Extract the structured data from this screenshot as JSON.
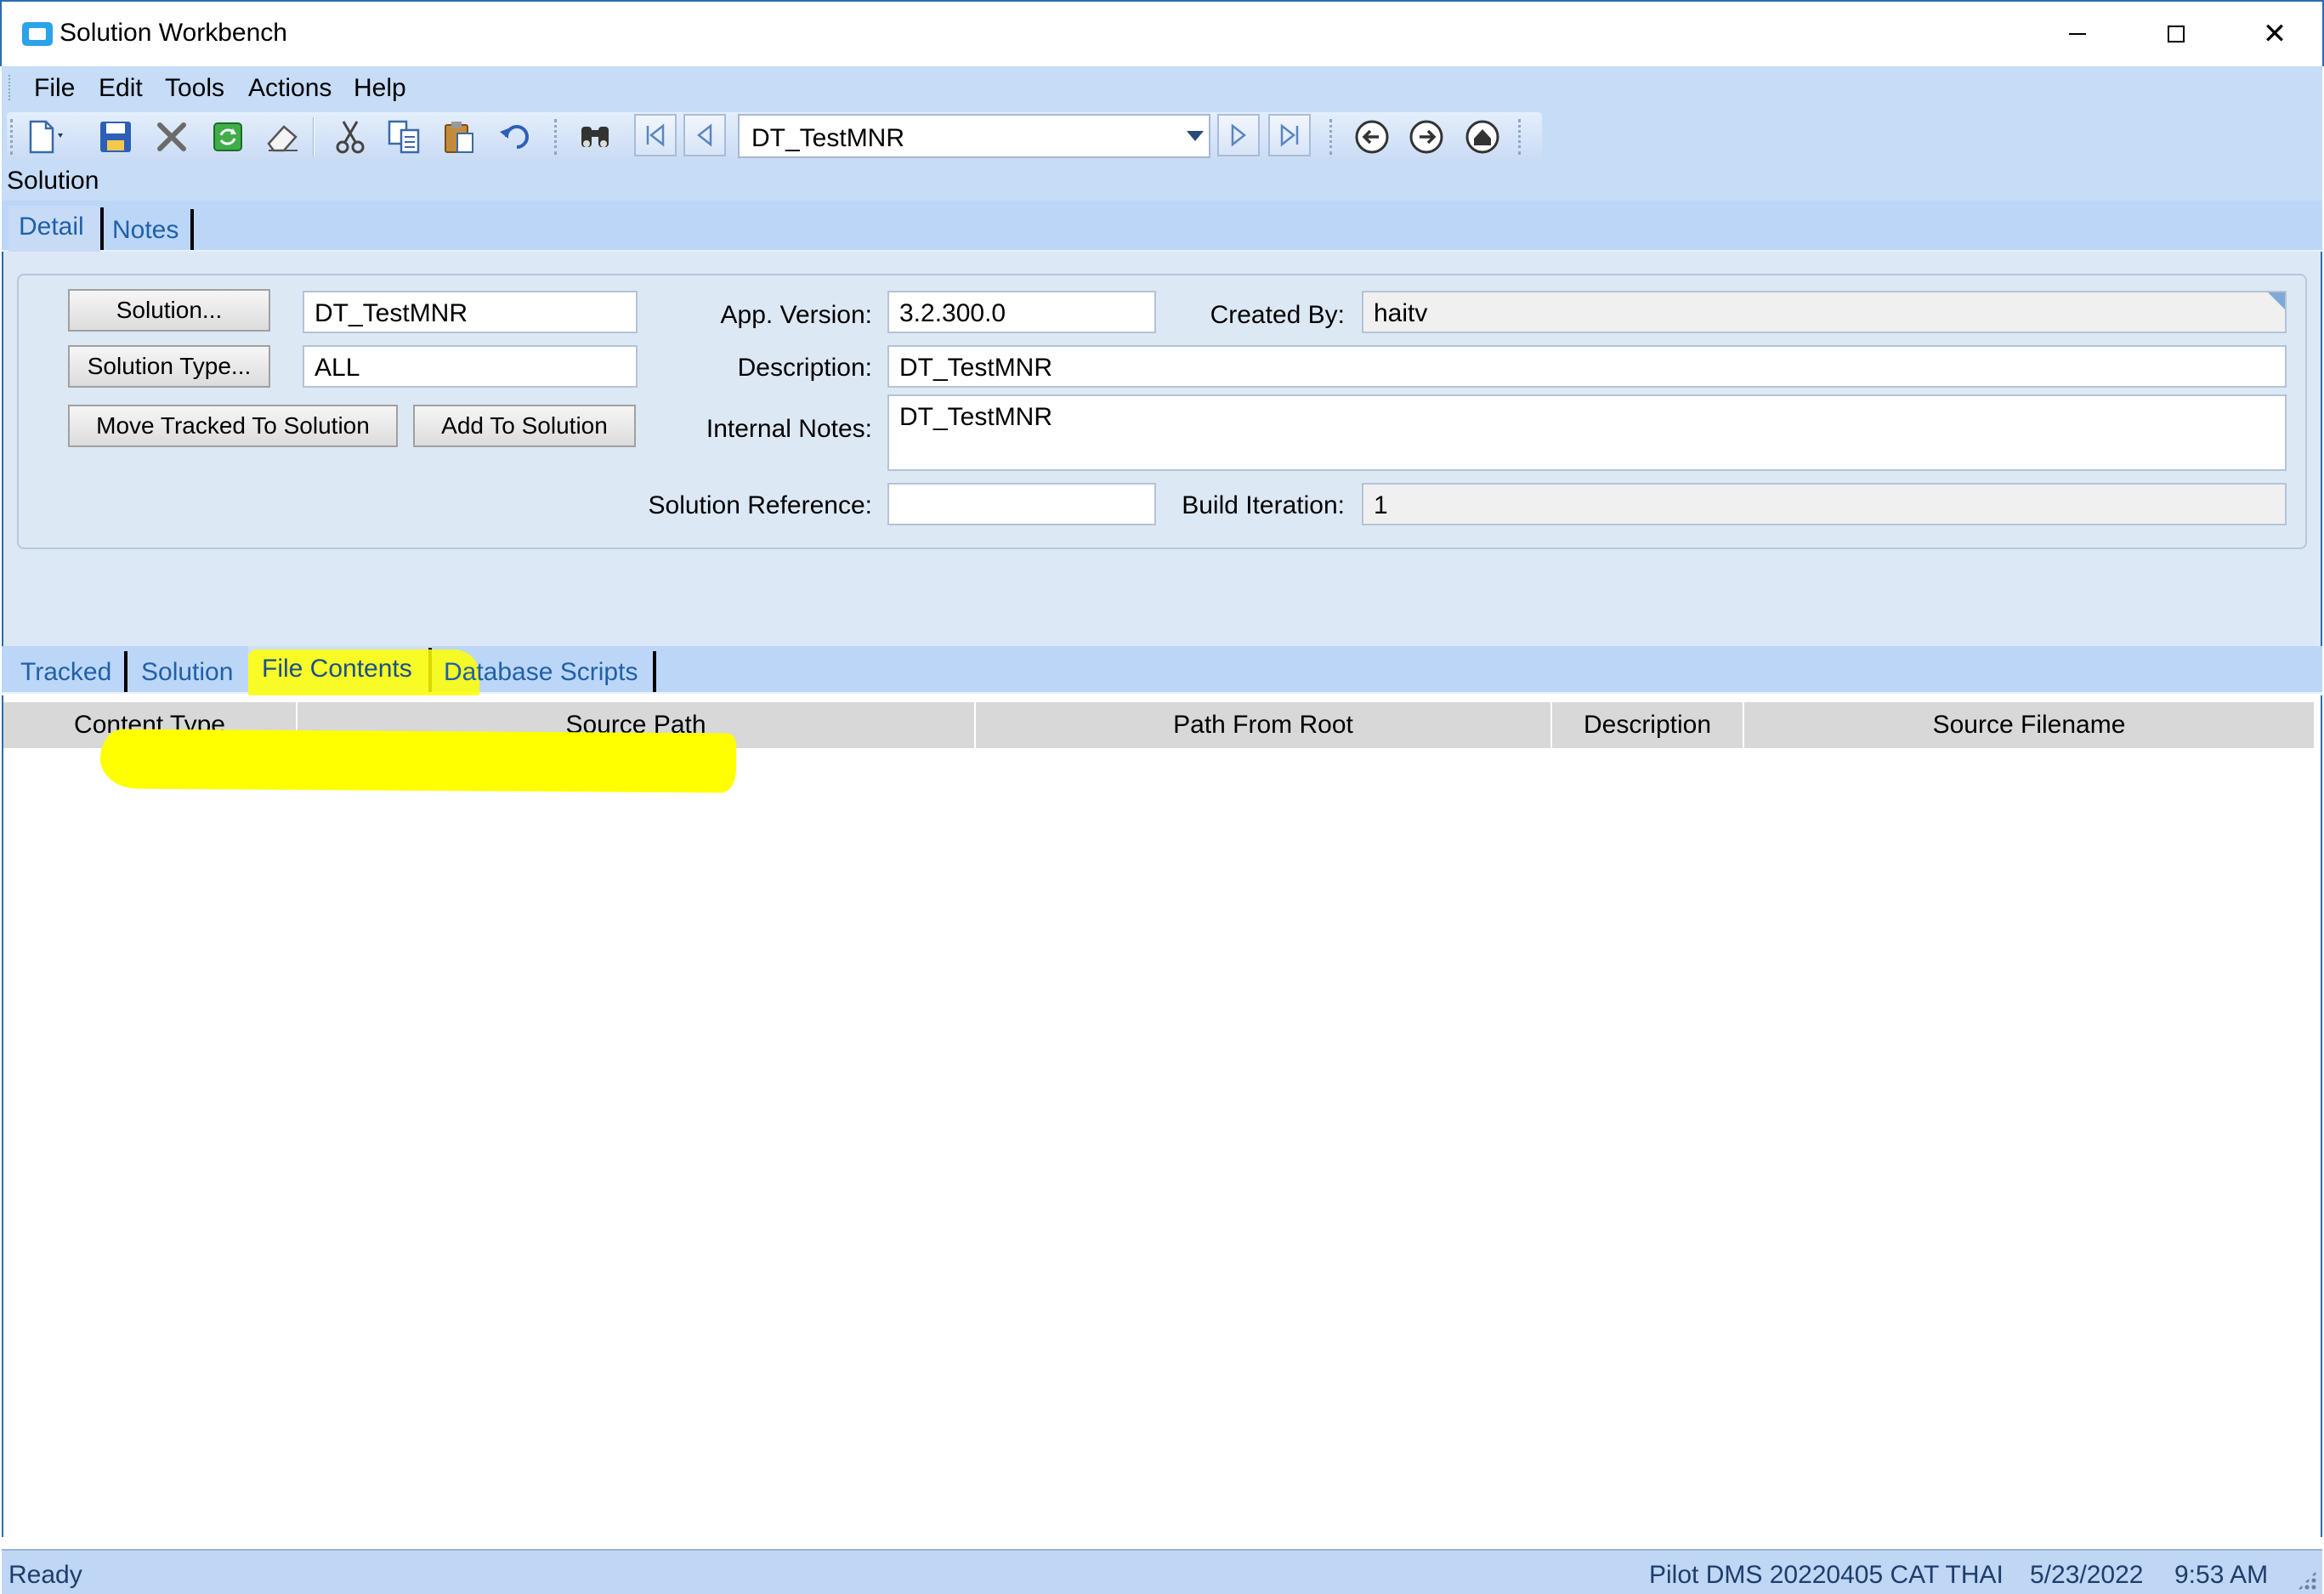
{
  "window": {
    "title": "Solution Workbench",
    "controls": {
      "minimize": "minimize",
      "maximize": "maximize",
      "close": "✕"
    }
  },
  "menu": [
    "File",
    "Edit",
    "Tools",
    "Actions",
    "Help"
  ],
  "toolbar": {
    "icons": [
      "new-document-icon",
      "save-icon",
      "delete-icon",
      "refresh-icon",
      "eraser-icon",
      "cut-icon",
      "copy-icon",
      "paste-icon",
      "undo-icon",
      "find-binoculars-icon",
      "first-record-icon",
      "previous-record-icon",
      "next-record-icon",
      "last-record-icon",
      "back-icon",
      "forward-icon",
      "home-icon"
    ],
    "record_selector": "DT_TestMNR"
  },
  "section_label": "Solution",
  "top_tabs": [
    {
      "label": "Detail",
      "active": true
    },
    {
      "label": "Notes",
      "active": false
    }
  ],
  "detail": {
    "solution_button": "Solution...",
    "solution_value": "DT_TestMNR",
    "solution_type_button": "Solution Type...",
    "solution_type_value": "ALL",
    "move_tracked_button": "Move Tracked To Solution",
    "add_to_solution_button": "Add To Solution",
    "app_version_label": "App. Version:",
    "app_version_value": "3.2.300.0",
    "created_by_label": "Created By:",
    "created_by_value": "haitv",
    "description_label": "Description:",
    "description_value": "DT_TestMNR",
    "internal_notes_label": "Internal Notes:",
    "internal_notes_value": "DT_TestMNR",
    "solution_reference_label": "Solution Reference:",
    "solution_reference_value": "",
    "build_iteration_label": "Build Iteration:",
    "build_iteration_value": "1"
  },
  "bottom_tabs": [
    {
      "label": "Tracked",
      "active": false
    },
    {
      "label": "Solution",
      "active": false
    },
    {
      "label": "File Contents",
      "active": true
    },
    {
      "label": "Database Scripts",
      "active": false
    }
  ],
  "grid": {
    "columns": [
      "Content Type",
      "Source Path",
      "Path From Root",
      "Description",
      "Source Filename"
    ],
    "rows": []
  },
  "status": {
    "left": "Ready",
    "environment": "Pilot DMS 20220405 CAT THAI",
    "date": "5/23/2022",
    "time": "9:53 AM"
  },
  "colors": {
    "accent": "#2b6cb0",
    "toolbar_bg": "#c6dcf7",
    "tab_text": "#2060a8",
    "highlight": "#ffff00"
  }
}
